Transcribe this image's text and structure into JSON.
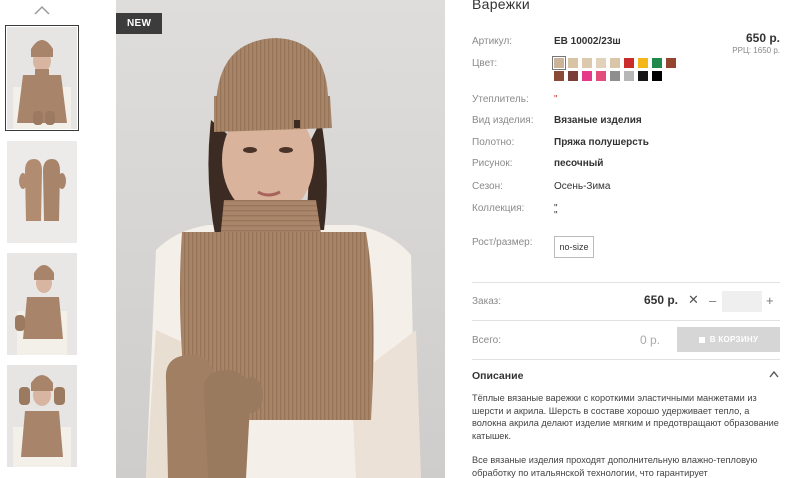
{
  "product": {
    "title": "Варежки",
    "badge": "NEW",
    "price": "650 р.",
    "rrc": "РРЦ: 1650 р."
  },
  "attributes": {
    "article": {
      "label": "Артикул:",
      "value": "ЕВ 10002/23ш"
    },
    "color": {
      "label": "Цвет:"
    },
    "insulation": {
      "label": "Утеплитель:",
      "value": "\""
    },
    "type": {
      "label": "Вид изделия:",
      "value": "Вязаные изделия"
    },
    "fabric": {
      "label": "Полотно:",
      "value": "Пряжа полушерсть"
    },
    "pattern": {
      "label": "Рисунок:",
      "value": "песочный"
    },
    "season": {
      "label": "Сезон:",
      "value": "Осень-Зима"
    },
    "collection": {
      "label": "Коллекция:",
      "value": "\"",
      "value2": "\""
    },
    "size": {
      "label": "Рост/размер:",
      "option": "no-size"
    }
  },
  "swatches": [
    "#cbb39a",
    "#d8c3a5",
    "#dccaae",
    "#e2d2b9",
    "#d9c5a8",
    "#cc2b2b",
    "#f3b71b",
    "#1f8a4c",
    "#93452f",
    "#8a4a36",
    "#7a3f36",
    "#e53a8a",
    "#e24d7c",
    "#8e8e8e",
    "#b7b7b7",
    "#141414",
    "#000000"
  ],
  "order": {
    "label": "Заказ:",
    "price": "650 р.",
    "quantity": ""
  },
  "total": {
    "label": "Всего:",
    "value": "0 р.",
    "cart_button": "В КОРЗИНУ"
  },
  "description": {
    "title": "Описание",
    "paragraph1": "Тёплые вязаные варежки с короткими эластичными манжетами из шерсти и акрила. Шерсть в составе хорошо удерживает тепло, а волокна акрила делают изделие мягким и предотвращают образование катышек.",
    "paragraph2": "Все вязаные изделия проходят дополнительную влажно-тепловую обработку по итальянской технологии, что гарантирует"
  },
  "icons": {
    "thumbs_up": "chevron-up-icon",
    "times": "times-icon",
    "cart": "cart-icon",
    "desc_toggle": "chevron-up-icon"
  }
}
